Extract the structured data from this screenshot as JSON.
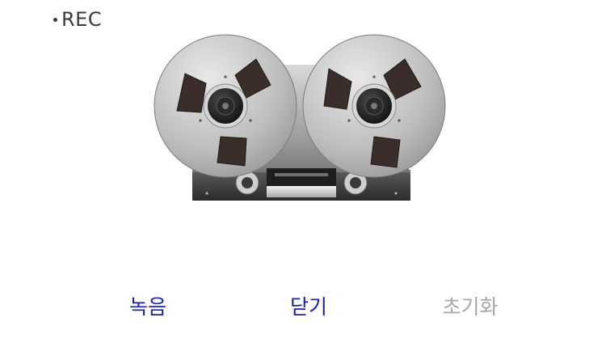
{
  "status": {
    "rec_label": "REC"
  },
  "controls": {
    "record_label": "녹음",
    "close_label": "닫기",
    "reset_label": "초기화"
  },
  "colors": {
    "action_enabled": "#1a1fb0",
    "action_disabled": "#a7a7a7",
    "status_text": "#3a3a3a"
  },
  "icons": {
    "deck": "reel-to-reel-tape-recorder-icon"
  }
}
